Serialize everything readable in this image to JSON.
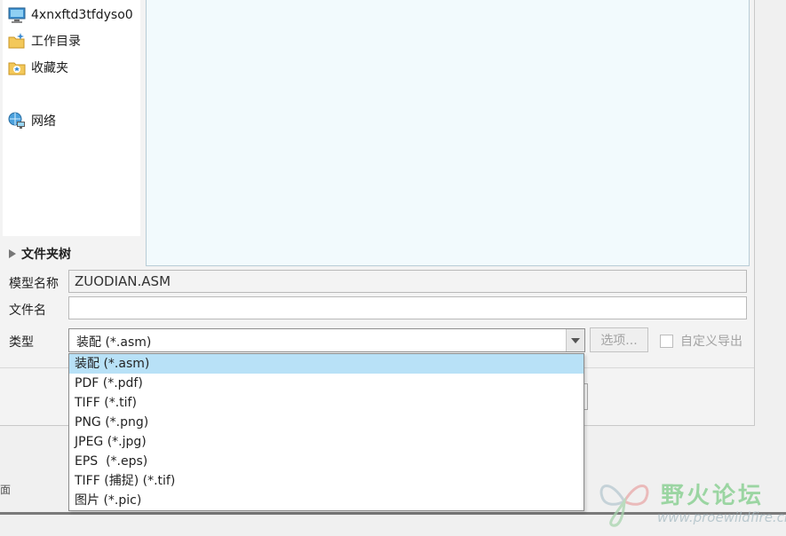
{
  "nav": {
    "items": [
      {
        "label": "4xnxftd3tfdyso0",
        "icon": "computer-icon"
      },
      {
        "label": "工作目录",
        "icon": "working-directory-icon"
      },
      {
        "label": "收藏夹",
        "icon": "favorites-icon"
      },
      {
        "label": "网络",
        "icon": "network-icon"
      }
    ],
    "tree_label": "文件夹树"
  },
  "form": {
    "model_name_label": "模型名称",
    "model_name_value": "ZUODIAN.ASM",
    "file_name_label": "文件名",
    "file_name_value": "",
    "type_label": "类型",
    "type_value": "装配 (*.asm)",
    "options_label": "选项...",
    "custom_export_label": "自定义导出"
  },
  "dropdown": {
    "options": [
      "装配 (*.asm)",
      "PDF (*.pdf)",
      "TIFF (*.tif)",
      "PNG (*.png)",
      "JPEG (*.jpg)",
      "EPS  (*.eps)",
      "TIFF (捕捉) (*.tif)",
      "图片 (*.pic)"
    ],
    "selected_index": 0
  },
  "bottom": {
    "partial_text": "面"
  },
  "watermark": {
    "title": "野火论坛",
    "url": "www.proewildfire.cn"
  },
  "colors": {
    "selection": "#b8e1f7",
    "preview_bg": "#f2fafd",
    "watermark_green": "#7fcd88"
  }
}
